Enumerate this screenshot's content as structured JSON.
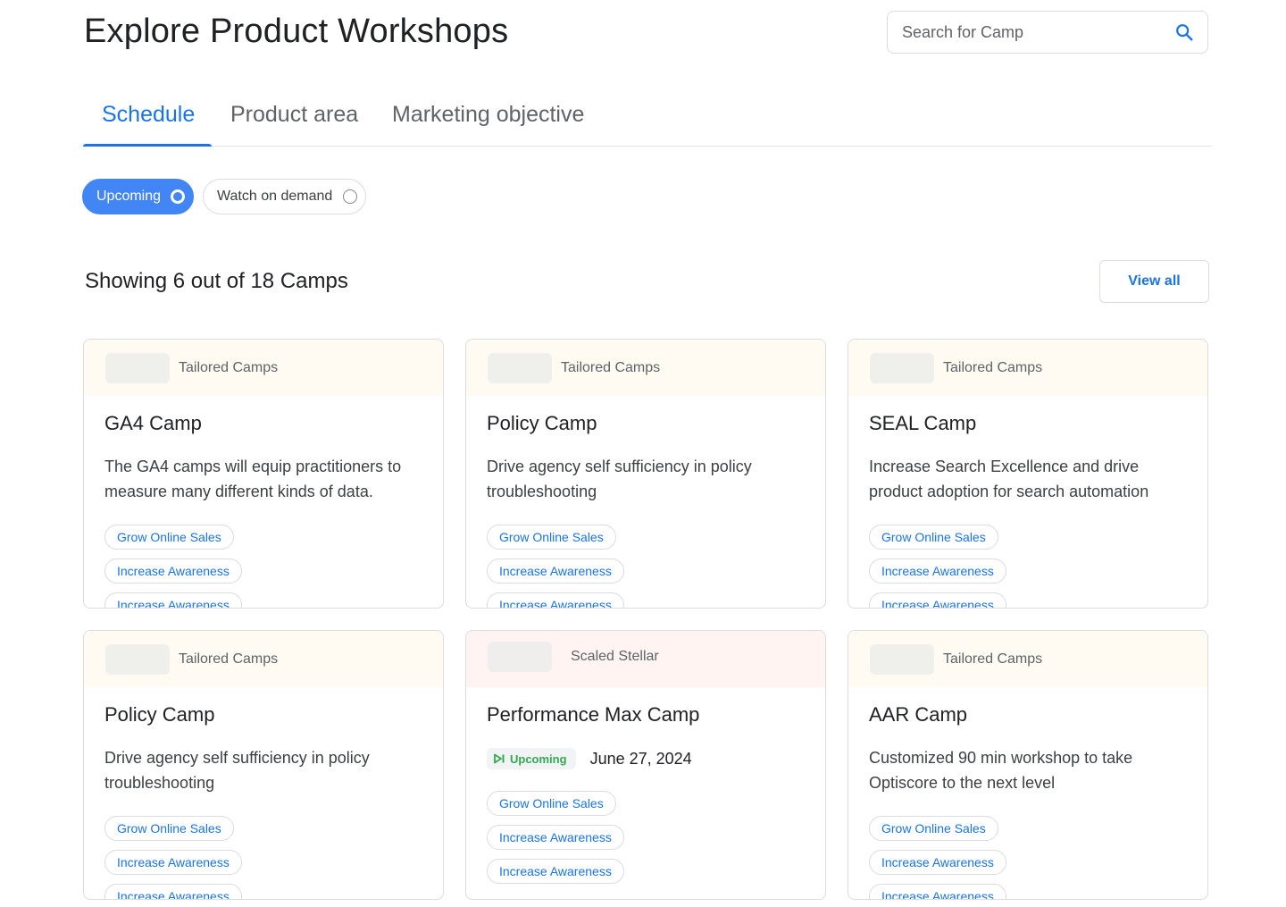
{
  "header": {
    "title": "Explore Product Workshops",
    "search_placeholder": "Search for Camp"
  },
  "tabs": [
    {
      "label": "Schedule",
      "active": true
    },
    {
      "label": "Product area",
      "active": false
    },
    {
      "label": "Marketing objective",
      "active": false
    }
  ],
  "filters": {
    "upcoming": "Upcoming",
    "on_demand": "Watch on demand",
    "selected": "Upcoming"
  },
  "results": {
    "showing": "Showing 6 out of 18 Camps",
    "view_all": "View all"
  },
  "cards": [
    {
      "category": "Tailored Camps",
      "title": "GA4 Camp",
      "description": "The GA4 camps will equip practitioners to measure many different kinds of data.",
      "tags": [
        "Grow Online Sales",
        "Increase Awareness",
        "Increase Awareness"
      ]
    },
    {
      "category": "Tailored Camps",
      "title": "Policy Camp",
      "description": "Drive agency self sufficiency in policy troubleshooting",
      "tags": [
        "Grow Online Sales",
        "Increase Awareness",
        "Increase Awareness"
      ]
    },
    {
      "category": "Tailored Camps",
      "title": "SEAL Camp",
      "description": "Increase Search Excellence and drive product adoption for search automation",
      "tags": [
        "Grow Online Sales",
        "Increase Awareness",
        "Increase Awareness"
      ]
    },
    {
      "category": "Tailored Camps",
      "title": "Policy Camp",
      "description": "Drive agency self sufficiency in policy troubleshooting",
      "tags": [
        "Grow Online Sales",
        "Increase Awareness",
        "Increase Awareness"
      ]
    },
    {
      "category": "Scaled Stellar",
      "title": "Performance Max Camp",
      "status": "Upcoming",
      "date": "June 27, 2024",
      "tags": [
        "Grow Online Sales",
        "Increase Awareness",
        "Increase Awareness"
      ]
    },
    {
      "category": "Tailored Camps",
      "title": "AAR Camp",
      "description": "Customized 90 min workshop to take Optiscore to the next level",
      "tags": [
        "Grow Online Sales",
        "Increase Awareness",
        "Increase Awareness"
      ]
    }
  ],
  "colors": {
    "accent": "#1a73e8",
    "chip_active": "#4285f4",
    "status_green": "#34a853",
    "tailored_header": "#fffbf2",
    "stellar_header": "#fff4f2"
  },
  "icons": {
    "search": "search-icon",
    "status": "play-skip-icon"
  }
}
